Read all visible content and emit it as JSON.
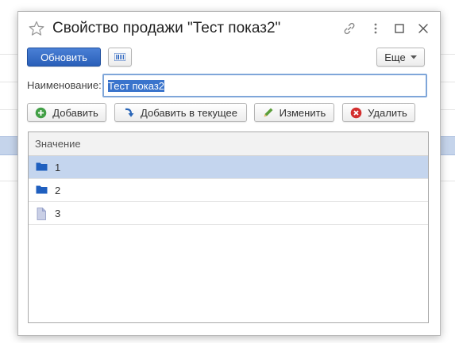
{
  "dialog": {
    "title": "Свойство продажи \"Тест показ2\""
  },
  "toolbar": {
    "refresh_label": "Обновить",
    "more_label": "Еще"
  },
  "form": {
    "name_label": "Наименование:",
    "name_value": "Тест показ2"
  },
  "actions": {
    "add_label": "Добавить",
    "add_to_current_label": "Добавить в текущее",
    "edit_label": "Изменить",
    "delete_label": "Удалить"
  },
  "table": {
    "column_header": "Значение",
    "rows": [
      {
        "value": "1",
        "type": "folder",
        "selected": true
      },
      {
        "value": "2",
        "type": "folder",
        "selected": false
      },
      {
        "value": "3",
        "type": "item",
        "selected": false
      }
    ]
  },
  "icons": {
    "favorite": "star-icon",
    "link": "link-icon",
    "menu": "more-vertical-icon",
    "maximize": "maximize-icon",
    "close": "close-icon",
    "barcode": "barcode-icon",
    "dropdown": "chevron-down-icon",
    "add": "plus-circle-icon",
    "add_to_current": "arrow-down-icon",
    "edit": "pencil-icon",
    "delete": "delete-circle-icon",
    "folder": "folder-icon",
    "item": "document-icon"
  },
  "colors": {
    "primary_button": "#2a5fb8",
    "selection": "#c4d5ee",
    "add_icon": "#43a047",
    "delete_icon": "#d32f2f",
    "folder_icon": "#1f5fbf"
  }
}
